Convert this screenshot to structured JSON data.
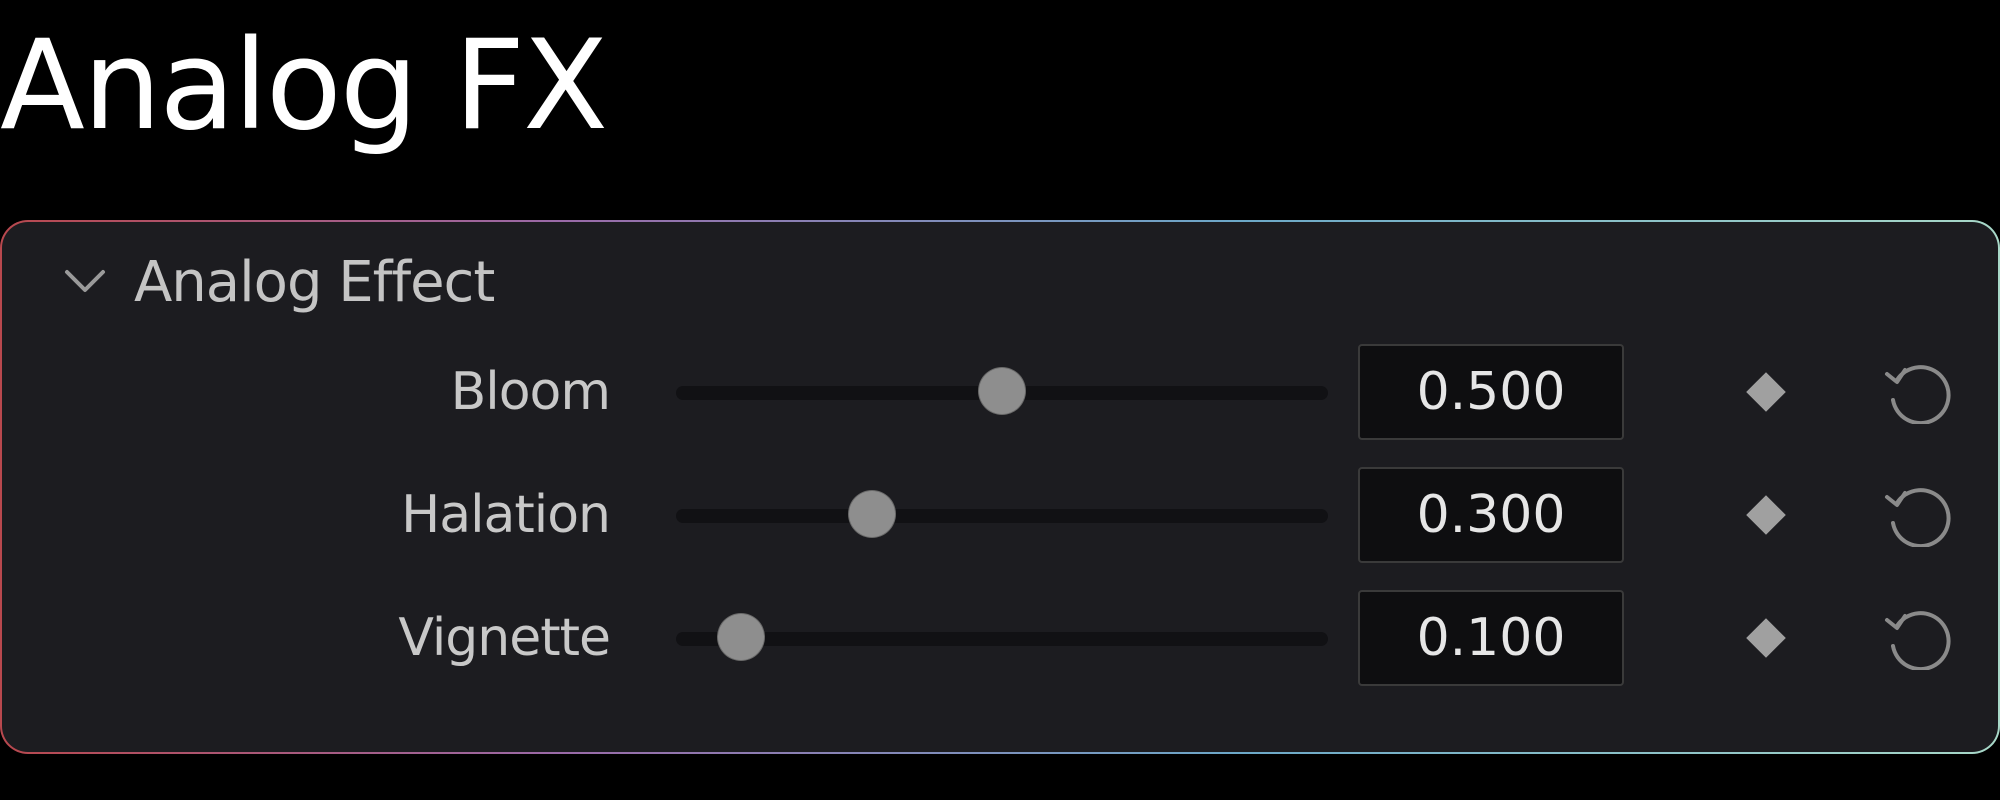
{
  "page": {
    "title": "Analog FX"
  },
  "panel": {
    "header": {
      "label": "Analog Effect",
      "expanded": true,
      "chevron_icon": "chevron-down-icon"
    },
    "params": [
      {
        "label": "Bloom",
        "value": "0.500",
        "slider_fraction": 0.5
      },
      {
        "label": "Halation",
        "value": "0.300",
        "slider_fraction": 0.3
      },
      {
        "label": "Vignette",
        "value": "0.100",
        "slider_fraction": 0.1
      }
    ],
    "row_icons": {
      "keyframe": "diamond-keyframe-icon",
      "reset": "reset-icon"
    }
  },
  "colors": {
    "background": "#000000",
    "panel": "#1c1c20",
    "thumb": "#8e8e8e",
    "icon": "#9a9a9a"
  }
}
